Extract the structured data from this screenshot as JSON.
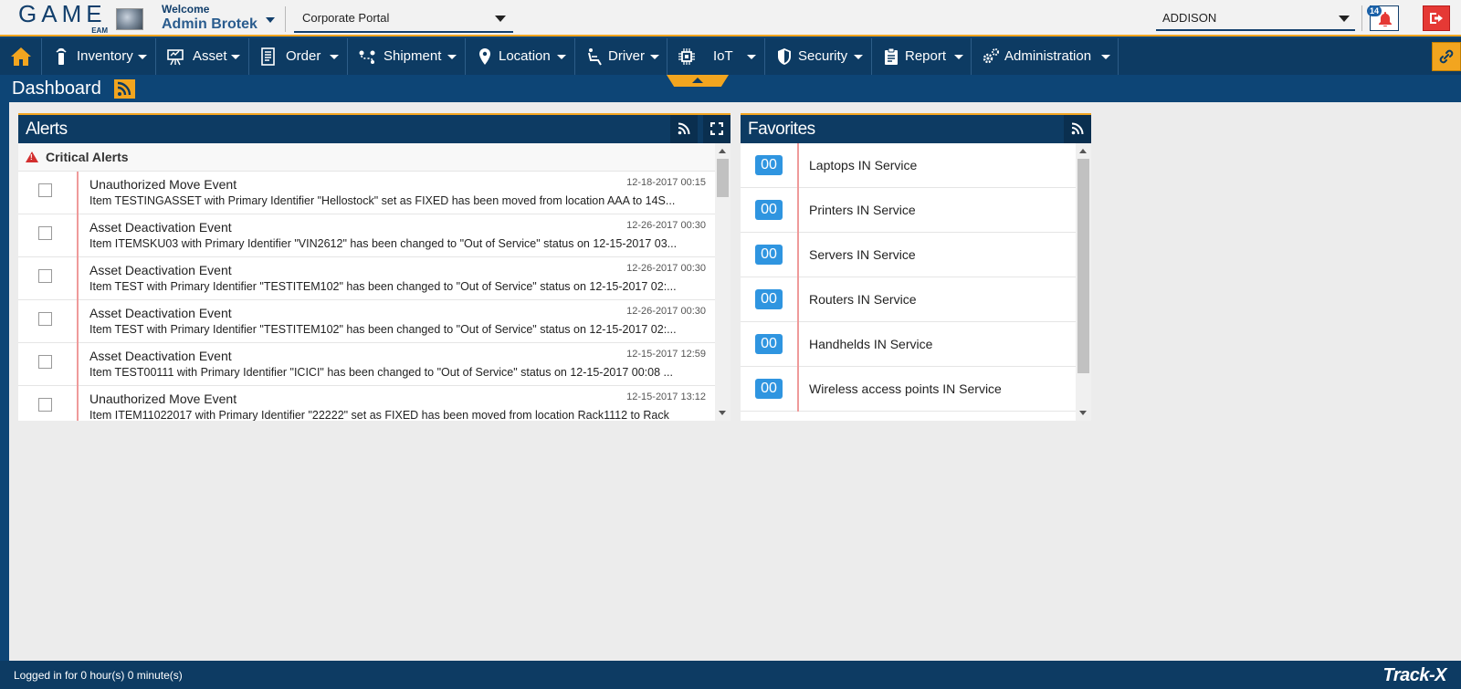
{
  "header": {
    "logo_text": "GAME",
    "logo_sub": "EAM",
    "welcome_label": "Welcome",
    "user_name": "Admin Brotek",
    "portal_selected": "Corporate Portal",
    "site_selected": "ADDISON",
    "notification_count": "14"
  },
  "nav": {
    "items": [
      {
        "label": "Inventory",
        "icon": "rfid-tag-icon"
      },
      {
        "label": "Asset",
        "icon": "asset-icon"
      },
      {
        "label": "Order",
        "icon": "order-icon"
      },
      {
        "label": "Shipment",
        "icon": "shipment-route-icon"
      },
      {
        "label": "Location",
        "icon": "map-pin-icon"
      },
      {
        "label": "Driver",
        "icon": "driver-seat-icon"
      },
      {
        "label": "IoT",
        "icon": "chip-icon"
      },
      {
        "label": "Security",
        "icon": "shield-icon"
      },
      {
        "label": "Report",
        "icon": "clipboard-icon"
      },
      {
        "label": "Administration",
        "icon": "gears-icon"
      }
    ]
  },
  "page": {
    "title": "Dashboard"
  },
  "alerts": {
    "title": "Alerts",
    "section_title": "Critical Alerts",
    "rows": [
      {
        "event": "Unauthorized Move Event",
        "timestamp": "12-18-2017 00:15",
        "message": "Item TESTINGASSET with Primary Identifier \"Hellostock\" set as FIXED has been moved from location AAA to 14S..."
      },
      {
        "event": "Asset Deactivation Event",
        "timestamp": "12-26-2017 00:30",
        "message": "Item ITEMSKU03 with Primary Identifier \"VIN2612\" has been changed to \"Out of Service\" status on 12-15-2017 03..."
      },
      {
        "event": "Asset Deactivation Event",
        "timestamp": "12-26-2017 00:30",
        "message": "Item TEST with Primary Identifier \"TESTITEM102\" has been changed to \"Out of Service\" status on 12-15-2017 02:..."
      },
      {
        "event": "Asset Deactivation Event",
        "timestamp": "12-26-2017 00:30",
        "message": "Item TEST with Primary Identifier \"TESTITEM102\" has been changed to \"Out of Service\" status on 12-15-2017 02:..."
      },
      {
        "event": "Asset Deactivation Event",
        "timestamp": "12-15-2017 12:59",
        "message": "Item TEST00111 with Primary Identifier \"ICICI\" has been changed to \"Out of Service\" status on 12-15-2017 00:08 ..."
      },
      {
        "event": "Unauthorized Move Event",
        "timestamp": "12-15-2017 13:12",
        "message": "Item ITEM11022017 with Primary Identifier \"22222\" set as FIXED has been moved from location Rack1112 to Rack"
      }
    ]
  },
  "favorites": {
    "title": "Favorites",
    "rows": [
      {
        "count": "00",
        "label": "Laptops IN Service"
      },
      {
        "count": "00",
        "label": "Printers IN Service"
      },
      {
        "count": "00",
        "label": "Servers IN Service"
      },
      {
        "count": "00",
        "label": "Routers IN Service"
      },
      {
        "count": "00",
        "label": "Handhelds IN Service"
      },
      {
        "count": "00",
        "label": "Wireless access points IN Service"
      }
    ]
  },
  "footer": {
    "login_status": "Logged in for 0 hour(s) 0 minute(s)",
    "brand": "Track-X"
  },
  "colors": {
    "navy": "#0d3b63",
    "accent_orange": "#f2a51f",
    "alert_red": "#d32f2f",
    "count_blue": "#2f95e0"
  }
}
